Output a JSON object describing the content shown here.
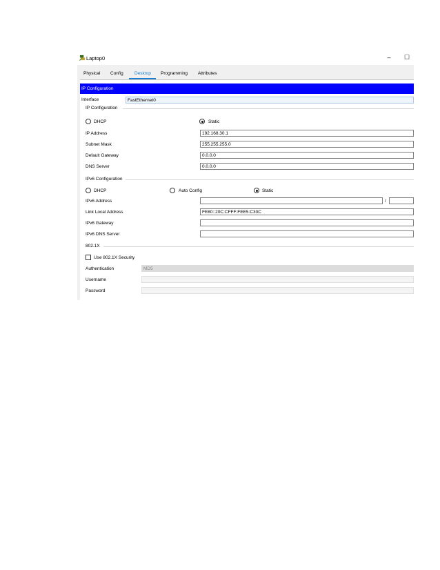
{
  "window": {
    "title": "Laptop0",
    "minimize_glyph": "–",
    "maximize_glyph": "☐"
  },
  "tabs": [
    {
      "label": "Physical"
    },
    {
      "label": "Config"
    },
    {
      "label": "Desktop",
      "active": true
    },
    {
      "label": "Programming"
    },
    {
      "label": "Attributes"
    }
  ],
  "ip_config": {
    "header": "IP Configuration",
    "interface_label": "Interface",
    "interface_value": "FastEthernet0",
    "ipv4_group_title": "IP Configuration",
    "dhcp_label": "DHCP",
    "static_label": "Static",
    "mode": "static",
    "ip_address_label": "IP Address",
    "ip_address_value": "192.168.30.1",
    "subnet_mask_label": "Subnet Mask",
    "subnet_mask_value": "255.255.255.0",
    "gateway_label": "Default Gateway",
    "gateway_value": "0.0.0.0",
    "dns_label": "DNS Server",
    "dns_value": "0.0.0.0"
  },
  "ipv6_config": {
    "group_title": "IPv6 Configuration",
    "dhcp_label": "DHCP",
    "auto_label": "Auto Config",
    "static_label": "Static",
    "mode": "static",
    "address_label": "IPv6 Address",
    "address_value": "",
    "prefix_separator": "/",
    "prefix_value": "",
    "link_local_label": "Link Local Address",
    "link_local_value": "FE80::20C:CFFF:FEE5:C30C",
    "gateway_label": "IPv6 Gateway",
    "gateway_value": "",
    "dns_label": "IPv6 DNS Server",
    "dns_value": ""
  },
  "dot1x": {
    "group_title": "802.1X",
    "use_security_label": "Use 802.1X Security",
    "use_security_checked": false,
    "authentication_label": "Authentication",
    "authentication_value": "MD5",
    "username_label": "Username",
    "username_value": "",
    "password_label": "Password",
    "password_value": ""
  },
  "colors": {
    "header_bar": "#0000ff",
    "active_tab": "#1a7fd1"
  },
  "icons": {
    "app": "laptop-icon"
  }
}
